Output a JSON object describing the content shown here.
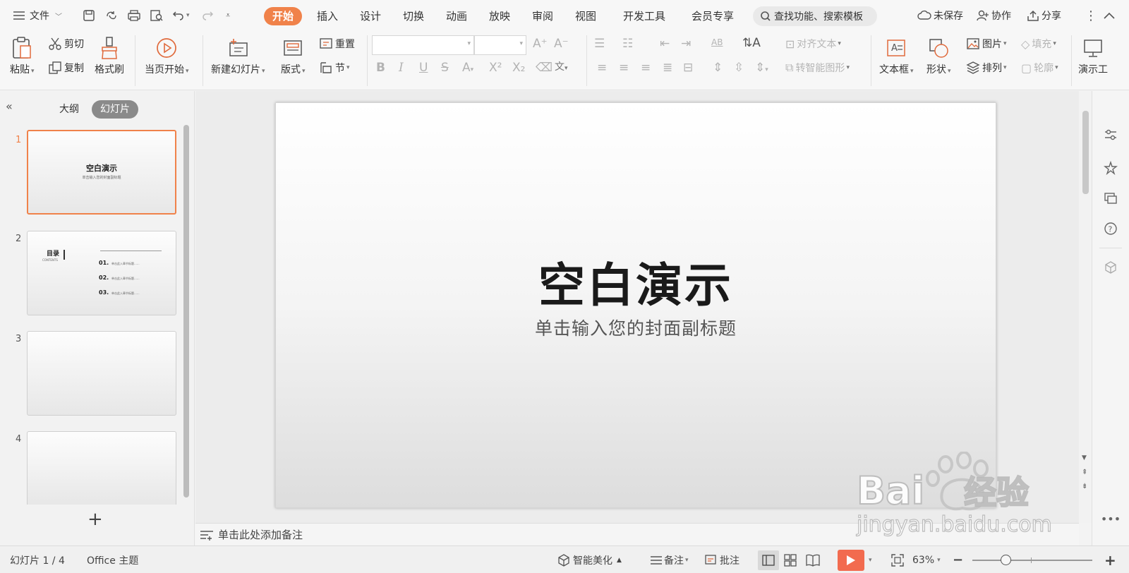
{
  "titlebar": {
    "file_menu": "文件",
    "tabs": [
      "开始",
      "插入",
      "设计",
      "切换",
      "动画",
      "放映",
      "审阅",
      "视图",
      "开发工具",
      "会员专享"
    ],
    "active_tab": "开始",
    "search_placeholder": "查找功能、搜索模板",
    "unsaved": "未保存",
    "collaborate": "协作",
    "share": "分享"
  },
  "ribbon": {
    "paste": "粘贴",
    "cut": "剪切",
    "copy": "复制",
    "format_painter": "格式刷",
    "from_current": "当页开始",
    "new_slide": "新建幻灯片",
    "layout": "版式",
    "reset": "重置",
    "section": "节",
    "align_text": "对齐文本",
    "smart_art": "转智能图形",
    "textbox": "文本框",
    "shape": "形状",
    "picture": "图片",
    "arrange": "排列",
    "fill": "填充",
    "outline": "轮廓",
    "presentation_tools": "演示工"
  },
  "left_pane": {
    "outline_tab": "大纲",
    "slides_tab": "幻灯片",
    "thumbnails": [
      {
        "number": "1",
        "title": "空白演示",
        "subtitle": "单击输入您的封面副标题"
      },
      {
        "number": "2",
        "title": "目录",
        "contents": "CONTENTS",
        "items": [
          {
            "num": "01.",
            "text": "单击此入章节标题......"
          },
          {
            "num": "02.",
            "text": "单击此入章节标题......"
          },
          {
            "num": "03.",
            "text": "单击此入章节标题......"
          }
        ]
      },
      {
        "number": "3"
      },
      {
        "number": "4"
      }
    ],
    "add_symbol": "+"
  },
  "slide": {
    "title": "空白演示",
    "subtitle": "单击输入您的封面副标题"
  },
  "notes": {
    "placeholder": "单击此处添加备注"
  },
  "statusbar": {
    "slide_counter": "幻灯片 1 / 4",
    "theme": "Office 主题",
    "beautify": "智能美化",
    "notes": "备注",
    "comments": "批注",
    "zoom": "63%"
  },
  "watermark": {
    "brand": "Bai",
    "brand_suffix": "经验",
    "url": "jingyan.baidu.com"
  },
  "colors": {
    "accent": "#f0824a",
    "play_button": "#f26b4f"
  }
}
